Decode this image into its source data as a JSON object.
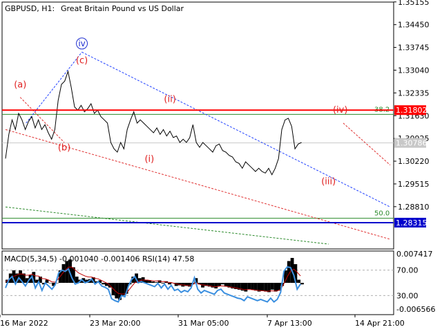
{
  "header": {
    "symbol": "GBPUSD, H1:",
    "description": "Great Britain Pound vs US Dollar"
  },
  "colors": {
    "price_line": "#000000",
    "wave_label": "#e02020",
    "wave_label_iv": "#1f2fd0",
    "resistance": "#ff0000",
    "support": "#0000cc",
    "fib_line": "#2a8a2a",
    "blue_dash": "#2040ff",
    "red_dash": "#e03030",
    "green_dash": "#2a8a2a",
    "macd_hist": "#000000",
    "macd_signal": "#c00000",
    "rsi_line": "#3a8fe0",
    "current_price_tag": "#c8c8c8",
    "grid": "#b0b0b0"
  },
  "chart_data": [
    {
      "type": "line",
      "x": [
        "16 Mar 2022",
        "23 Mar 20:00",
        "31 Mar 05:00",
        "7 Apr 13:00",
        "14 Apr 21:00"
      ],
      "x_index_range": [
        0,
        100
      ],
      "ylim": [
        1.275,
        1.3515
      ],
      "y_ticks": [
        "1.35155",
        "1.34450",
        "1.33745",
        "1.33040",
        "1.32335",
        "1.31630",
        "1.30925",
        "1.30220",
        "1.29515",
        "1.28810"
      ],
      "series": [
        {
          "values": [
            1.303,
            1.3105,
            1.315,
            1.312,
            1.317,
            1.315,
            1.312,
            1.3145,
            1.316,
            1.3125,
            1.315,
            1.312,
            1.3135,
            1.311,
            1.309,
            1.312,
            1.321,
            1.326,
            1.327,
            1.33,
            1.325,
            1.319,
            1.318,
            1.3195,
            1.3175,
            1.3185,
            1.32,
            1.317,
            1.318,
            1.316,
            1.315,
            1.314,
            1.308,
            1.306,
            1.305,
            1.308,
            1.306,
            1.312,
            1.315,
            1.3175,
            1.314,
            1.315,
            1.314,
            1.313,
            1.312,
            1.311,
            1.3125,
            1.3105,
            1.312,
            1.31,
            1.3115,
            1.3095,
            1.31,
            1.308,
            1.309,
            1.308,
            1.3095,
            1.3135,
            1.308,
            1.3065,
            1.308,
            1.307,
            1.306,
            1.305,
            1.307,
            1.3075,
            1.3055,
            1.305,
            1.304,
            1.3035,
            1.302,
            1.3015,
            1.3,
            1.302,
            1.301,
            1.3,
            1.299,
            1.3,
            1.299,
            1.2985,
            1.3,
            1.298,
            1.3,
            1.303,
            1.312,
            1.315,
            1.3155,
            1.313,
            1.306,
            1.3075,
            1.308
          ]
        }
      ],
      "hlines": [
        {
          "value": 1.31802,
          "tag": "1.31802"
        },
        {
          "value": 1.28315,
          "tag": "1.28315"
        }
      ],
      "fib_levels": [
        {
          "label": "38.2",
          "value": 1.3167
        },
        {
          "label": "50.0",
          "value": 1.2845
        }
      ],
      "current_price": {
        "value": 1.30786,
        "tag": "1.30786"
      },
      "wave_labels": [
        {
          "text": "(a)",
          "x": 5,
          "y": 1.325
        },
        {
          "text": "(b)",
          "x": 20,
          "y": 1.3055
        },
        {
          "text": "(c)",
          "x": 26,
          "y": 1.3325
        },
        {
          "text": "iv",
          "x": 26,
          "y": 1.3378
        },
        {
          "text": "(ii)",
          "x": 56,
          "y": 1.3205
        },
        {
          "text": "(i)",
          "x": 49,
          "y": 1.302
        },
        {
          "text": "(iv)",
          "x": 114,
          "y": 1.3172
        },
        {
          "text": "(iii)",
          "x": 110,
          "y": 1.295
        }
      ],
      "trendlines": [
        {
          "style": "blue_dash",
          "from": [
            7,
            1.314
          ],
          "to": [
            26,
            1.336
          ]
        },
        {
          "style": "blue_dash",
          "from": [
            26,
            1.336
          ],
          "to": [
            131,
            1.288
          ]
        },
        {
          "style": "red_dash",
          "from": [
            5,
            1.322
          ],
          "to": [
            20,
            1.308
          ]
        },
        {
          "style": "red_dash",
          "from": [
            0,
            1.312
          ],
          "to": [
            131,
            1.278
          ]
        },
        {
          "style": "red_dash",
          "from": [
            115,
            1.314
          ],
          "to": [
            131,
            1.301
          ]
        },
        {
          "style": "green_dash",
          "from": [
            0,
            1.288
          ],
          "to": [
            110,
            1.2765
          ]
        }
      ]
    },
    {
      "type": "line",
      "title": "MACD(5,34,5) -0.001040 -0.001406 RSI(14) 47.58",
      "ylim": [
        0,
        100
      ],
      "y_ticks": [
        "0.007417",
        "70.00",
        "30.00",
        "-0.006566"
      ],
      "series": [
        {
          "name": "RSI(14)",
          "values": [
            42,
            55,
            60,
            48,
            58,
            52,
            45,
            54,
            60,
            42,
            52,
            38,
            50,
            45,
            40,
            47,
            65,
            70,
            68,
            72,
            58,
            48,
            50,
            55,
            50,
            52,
            56,
            48,
            52,
            45,
            43,
            40,
            25,
            22,
            20,
            30,
            28,
            44,
            55,
            60,
            50,
            52,
            50,
            48,
            46,
            44,
            49,
            42,
            48,
            40,
            46,
            38,
            40,
            35,
            38,
            36,
            42,
            58,
            40,
            34,
            38,
            36,
            34,
            32,
            38,
            40,
            34,
            32,
            30,
            28,
            26,
            25,
            22,
            28,
            26,
            24,
            22,
            24,
            22,
            20,
            26,
            20,
            24,
            35,
            68,
            75,
            74,
            62,
            40,
            48
          ]
        },
        {
          "name": "MACD hist",
          "values": [
            10,
            30,
            40,
            30,
            40,
            30,
            15,
            25,
            35,
            10,
            20,
            -5,
            10,
            0,
            -10,
            0,
            40,
            60,
            70,
            75,
            50,
            20,
            10,
            15,
            10,
            12,
            18,
            5,
            8,
            -5,
            -10,
            -15,
            -40,
            -50,
            -55,
            -40,
            -35,
            -5,
            20,
            30,
            15,
            18,
            10,
            8,
            4,
            2,
            8,
            -2,
            5,
            -5,
            0,
            -10,
            -8,
            -12,
            -10,
            -12,
            -5,
            15,
            -5,
            -15,
            -10,
            -12,
            -15,
            -18,
            -10,
            -5,
            -12,
            -15,
            -18,
            -20,
            -22,
            -25,
            -28,
            -20,
            -22,
            -25,
            -28,
            -26,
            -28,
            -30,
            -22,
            -28,
            -25,
            -10,
            40,
            70,
            80,
            60,
            10,
            -5
          ]
        }
      ]
    }
  ]
}
